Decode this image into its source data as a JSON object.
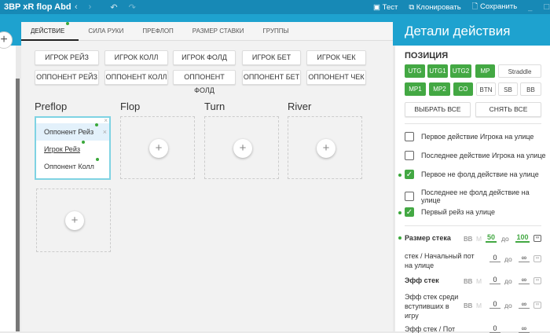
{
  "window": {
    "title": "3BP xR flop Abd",
    "test": "Тест",
    "clone": "Клонировать",
    "save": "Сохранить"
  },
  "tabs": [
    "ДЕЙСТВИЕ",
    "СИЛА РУКИ",
    "ПРЕФЛОП",
    "РАЗМЕР СТАВКИ",
    "ГРУППЫ"
  ],
  "actions_row1": [
    "ИГРОК РЕЙЗ",
    "ИГРОК КОЛЛ",
    "ИГРОК ФОЛД",
    "ИГРОК БЕТ",
    "ИГРОК ЧЕК"
  ],
  "actions_row2": [
    "ОППОНЕНТ РЕЙЗ",
    "ОППОНЕНТ КОЛЛ",
    "ОППОНЕНТ ФОЛД",
    "ОППОНЕНТ БЕТ",
    "ОППОНЕНТ ЧЕК"
  ],
  "streets": [
    "Preflop",
    "Flop",
    "Turn",
    "River"
  ],
  "preflop_card": [
    "Оппонент Рейз",
    "Игрок Рейз",
    "Оппонент Колл"
  ],
  "panel": {
    "title": "Детали действия",
    "position_label": "ПОЗИЦИЯ",
    "positions": [
      {
        "l": "UTG",
        "on": true
      },
      {
        "l": "UTG1",
        "on": true
      },
      {
        "l": "UTG2",
        "on": true
      },
      {
        "l": "MP",
        "on": true
      },
      {
        "l": "Straddle",
        "on": false
      },
      {
        "l": "MP1",
        "on": true
      },
      {
        "l": "MP2",
        "on": true
      },
      {
        "l": "CO",
        "on": true
      },
      {
        "l": "BTN",
        "on": false
      },
      {
        "l": "SB",
        "on": false
      },
      {
        "l": "BB",
        "on": false
      }
    ],
    "select_all": "ВЫБРАТЬ ВСЕ",
    "clear_all": "СНЯТЬ ВСЕ",
    "checks": [
      {
        "l": "Первое действие Игрока на улице",
        "on": false
      },
      {
        "l": "Последнее действие Игрока на улице",
        "on": false
      },
      {
        "l": "Первое не фолд действие на улице",
        "on": true
      },
      {
        "l": "Последнее не фолд действие на улице",
        "on": false
      },
      {
        "l": "Первый рейз на улице",
        "on": true
      }
    ],
    "stack": {
      "label": "Размер стека",
      "bb": "BB",
      "m": "M",
      "from": "50",
      "to_word": "до",
      "to": "100",
      "inf": "∞"
    },
    "pot": {
      "label": "стек / Начальный пот на улице",
      "from": "0",
      "to": "∞"
    },
    "eff": {
      "label": "Эфф стек",
      "from": "0",
      "to": "∞"
    },
    "eff_in": {
      "label": "Эфф стек среди вступивших в игру",
      "from": "0",
      "to": "∞"
    },
    "eff_pot": {
      "label": "Эфф стек / Пот",
      "from": "0",
      "to": "∞"
    }
  }
}
